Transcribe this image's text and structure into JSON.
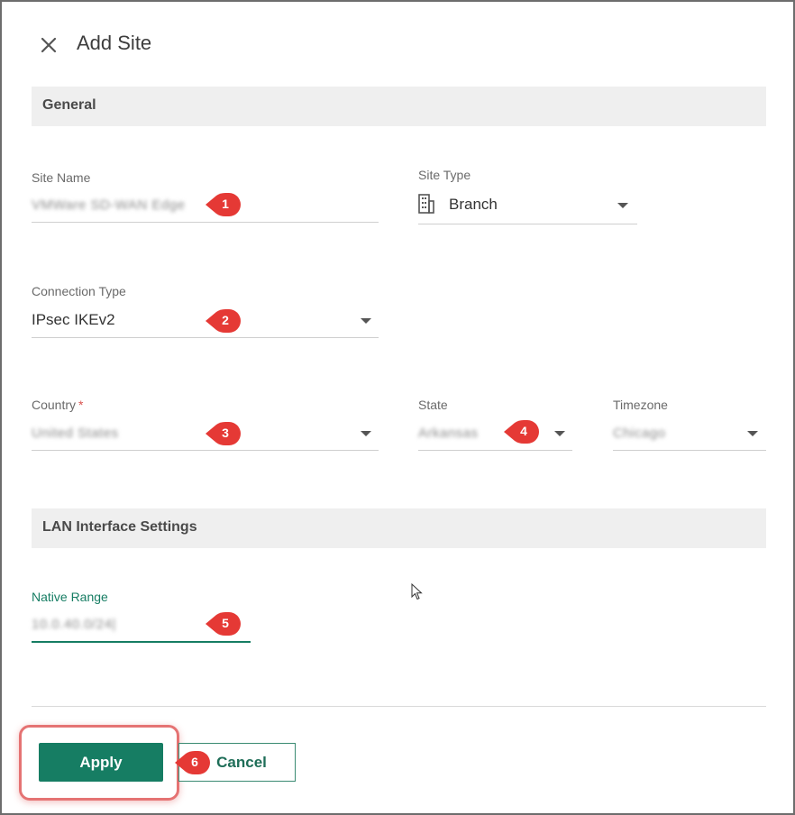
{
  "dialog": {
    "title": "Add Site"
  },
  "sections": {
    "general": "General",
    "lan": "LAN Interface Settings"
  },
  "fields": {
    "site_name": {
      "label": "Site Name",
      "value": "VMWare SD-WAN Edge"
    },
    "site_type": {
      "label": "Site Type",
      "value": "Branch",
      "icon": "building-icon"
    },
    "connection_type": {
      "label": "Connection Type",
      "value": "IPsec IKEv2"
    },
    "country": {
      "label": "Country",
      "required_mark": "*",
      "value": "United States"
    },
    "state": {
      "label": "State",
      "value": "Arkansas"
    },
    "timezone": {
      "label": "Timezone",
      "value": "Chicago"
    },
    "native_range": {
      "label": "Native Range",
      "value": "10.0.40.0/24|"
    }
  },
  "badges": [
    "1",
    "2",
    "3",
    "4",
    "5",
    "6"
  ],
  "buttons": {
    "apply": "Apply",
    "cancel": "Cancel"
  },
  "colors": {
    "accent": "#167d63",
    "badge": "#e53935",
    "highlight": "#e57373",
    "section_bg": "#efefef"
  }
}
